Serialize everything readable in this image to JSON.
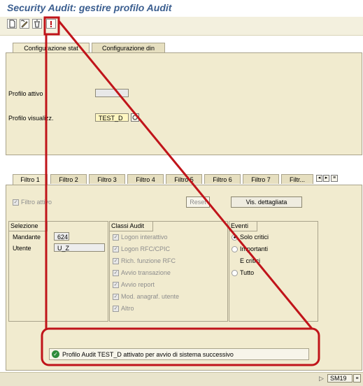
{
  "window": {
    "title": "Security Audit: gestire profilo Audit"
  },
  "toolbar": {
    "buttons": [
      "new-icon",
      "edit-icon",
      "delete-icon",
      "activate-icon"
    ]
  },
  "top_tabs": [
    {
      "label": "Configurazione stat",
      "active": true
    },
    {
      "label": "Configurazione din",
      "active": false
    }
  ],
  "config": {
    "active_profile_label": "Profilo attivo",
    "active_profile_value": "",
    "view_profile_label": "Profilo visualizz.",
    "view_profile_value": "TEST_D"
  },
  "filter_tabs": [
    {
      "label": "Filtro 1",
      "active": true
    },
    {
      "label": "Filtro 2",
      "active": false
    },
    {
      "label": "Filtro 3",
      "active": false
    },
    {
      "label": "Filtro 4",
      "active": false
    },
    {
      "label": "Filtro 5",
      "active": false
    },
    {
      "label": "Filtro 6",
      "active": false
    },
    {
      "label": "Filtro 7",
      "active": false
    },
    {
      "label": "Filtr...",
      "active": false
    }
  ],
  "filter": {
    "active_label": "Filtro attivo",
    "reset_label": "Reset",
    "details_label": "Vis. dettagliata"
  },
  "selection": {
    "header": "Selezione",
    "client_label": "Mandante",
    "client_value": "624",
    "user_label": "Utente",
    "user_value": "U_Z"
  },
  "audit_classes": {
    "header": "Classi Audit",
    "items": [
      "Logon interattivo",
      "Logon RFC/CPIC",
      "Rich. funzione RFC",
      "Avvio transazione",
      "Avvio report",
      "Mod. anagraf. utente",
      "Altro"
    ]
  },
  "events": {
    "header": "Eventi",
    "option_critical": "Solo critici",
    "option_important": "Importanti",
    "option_important_2": "E critici",
    "option_all": "Tutto",
    "selected": "Solo critici"
  },
  "status": {
    "message": "Profilo Audit TEST_D attivato per avvio di sistema successivo"
  },
  "footer": {
    "transaction": "SM19"
  },
  "colors": {
    "annotation": "#c0141a",
    "title": "#3b5e8f",
    "panel": "#f1ebcf"
  }
}
